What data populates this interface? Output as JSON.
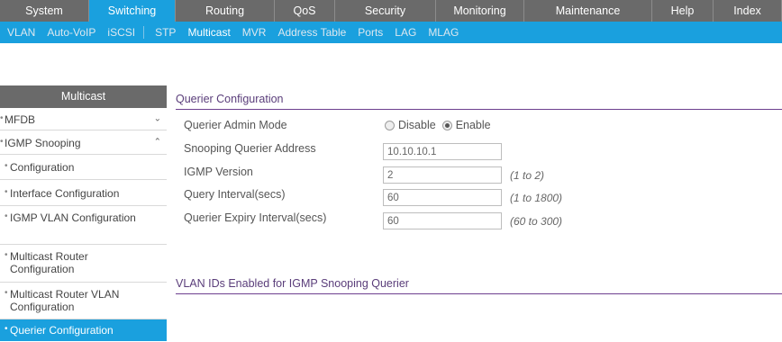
{
  "topnav": {
    "tabs": [
      {
        "label": "System",
        "width": 99
      },
      {
        "label": "Switching",
        "width": 96,
        "active": true
      },
      {
        "label": "Routing",
        "width": 110
      },
      {
        "label": "QoS",
        "width": 67
      },
      {
        "label": "Security",
        "width": 112
      },
      {
        "label": "Monitoring",
        "width": 98
      },
      {
        "label": "Maintenance",
        "width": 142
      },
      {
        "label": "Help",
        "width": 68
      },
      {
        "label": "Index",
        "width": 76
      }
    ]
  },
  "subnav": {
    "items": [
      {
        "label": "VLAN"
      },
      {
        "label": "Auto-VoIP"
      },
      {
        "label": "iSCSI"
      },
      {
        "label": "STP"
      },
      {
        "label": "Multicast",
        "active": true
      },
      {
        "label": "MVR"
      },
      {
        "label": "Address Table"
      },
      {
        "label": "Ports"
      },
      {
        "label": "LAG"
      },
      {
        "label": "MLAG"
      }
    ]
  },
  "sidebar": {
    "header": "Multicast",
    "items": [
      {
        "label": "MFDB",
        "chevron": "⌄"
      },
      {
        "label": "IGMP Snooping",
        "chevron": "⌃"
      },
      {
        "label": "Configuration"
      },
      {
        "label": "Interface Configuration"
      },
      {
        "label": "IGMP VLAN Configuration"
      },
      {
        "label": "Multicast Router Configuration"
      },
      {
        "label": "Multicast Router VLAN Configuration"
      },
      {
        "label": "Querier Configuration",
        "active": true
      }
    ]
  },
  "main": {
    "querier_title": "Querier Configuration",
    "vlan_title": "VLAN IDs Enabled for IGMP Snooping Querier",
    "admin_mode": {
      "label": "Querier Admin Mode",
      "options": [
        "Disable",
        "Enable"
      ],
      "selected": "Enable"
    },
    "snooping_address": {
      "label": "Snooping Querier Address",
      "value": "10.10.10.1"
    },
    "igmp_version": {
      "label": "IGMP Version",
      "value": "2",
      "hint": "(1 to 2)"
    },
    "query_interval": {
      "label": "Query Interval(secs)",
      "value": "60",
      "hint": "(1 to 1800)"
    },
    "expiry_interval": {
      "label": "Querier Expiry Interval(secs)",
      "value": "60",
      "hint": "(60 to 300)"
    }
  },
  "colors": {
    "nav_gray": "#6a6a6a",
    "accent_blue": "#1aa0de",
    "section_purple": "#6d3f8f"
  }
}
